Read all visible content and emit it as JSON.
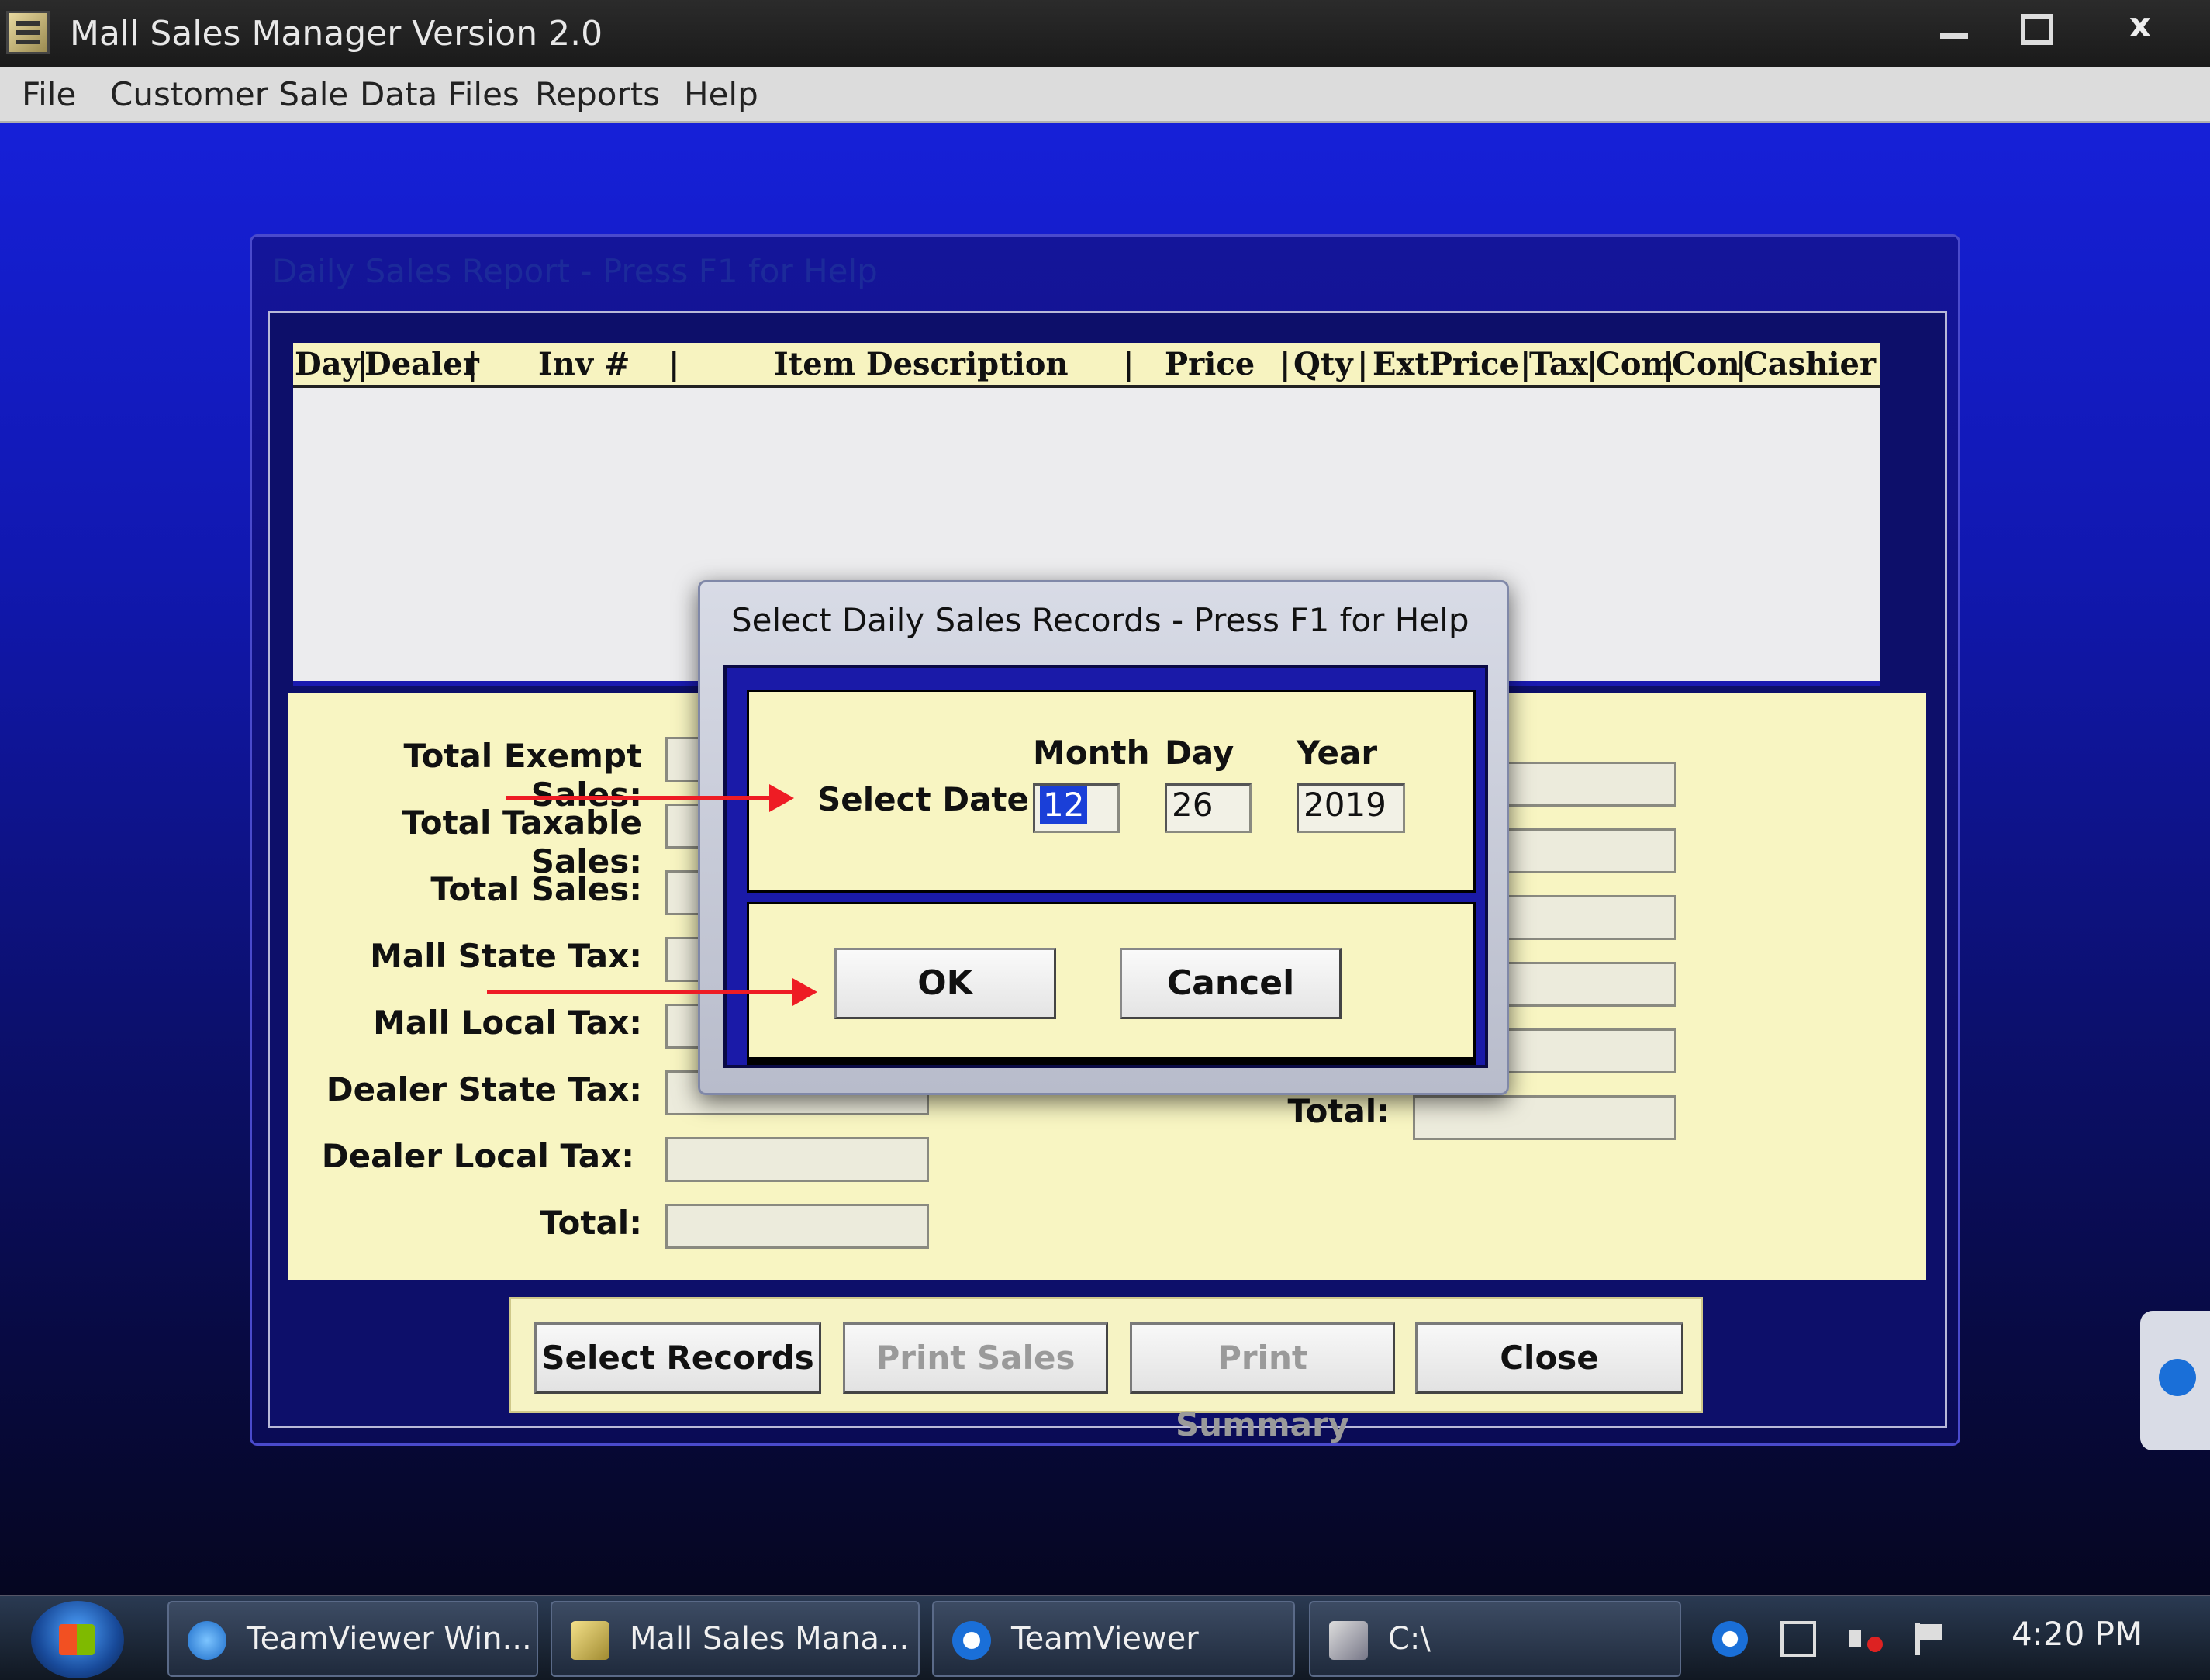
{
  "window": {
    "title": "Mall Sales Manager Version 2.0",
    "minimize": "",
    "maximize": "",
    "close": "x"
  },
  "menu": [
    "File",
    "Customer Sale",
    "Data Files",
    "Reports",
    "Help"
  ],
  "report": {
    "title": "Daily Sales Report - Press F1 for Help",
    "columns": [
      "Day",
      "|",
      "Dealer",
      "|",
      "Inv #",
      "|",
      "Item Description",
      "|",
      "Price",
      "|",
      "Qty",
      "|",
      "ExtPrice",
      "|",
      "Tax",
      "|",
      "Com",
      "|",
      "Con",
      "|",
      "Cashier"
    ],
    "summary_left": [
      "Total Exempt Sales:",
      "Total Taxable Sales:",
      "Total Sales:",
      "Mall State Tax:",
      "Mall Local Tax:",
      "Dealer State Tax:",
      "Dealer Local Tax:",
      "Total:"
    ],
    "summary_right_total": "Total:",
    "buttons": {
      "select_records": "Select Records",
      "print_sales": "Print Sales",
      "print_summary": "Print Summary",
      "close": "Close"
    }
  },
  "dialog": {
    "title": "Select Daily Sales Records - Press F1 for Help",
    "select_date_label": "Select Date",
    "month_label": "Month",
    "day_label": "Day",
    "year_label": "Year",
    "month_value": "12",
    "day_value": "26",
    "year_value": "2019",
    "ok_label": "OK",
    "cancel_label": "Cancel"
  },
  "taskbar": {
    "items": [
      "TeamViewer Win...",
      "Mall Sales Mana...",
      "TeamViewer",
      "C:\\"
    ],
    "clock": "4:20 PM"
  },
  "colors": {
    "annotation_arrow": "#ee1c24",
    "panel_yellow": "#f8f5c2",
    "window_blue": "#1620d8"
  }
}
